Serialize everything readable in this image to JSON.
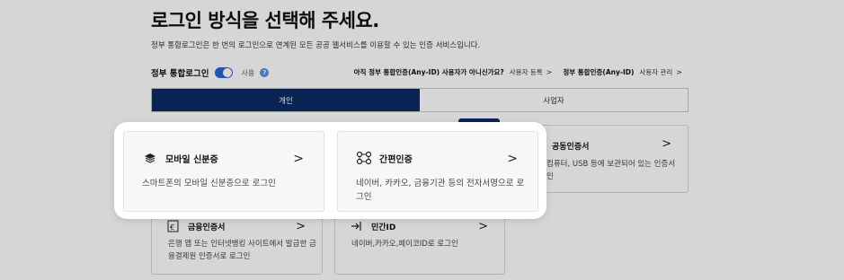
{
  "page": {
    "title": "로그인 방식을 선택해 주세요.",
    "description": "정부 통합로그인은 한 번의 로그인으로 연계된 모든 공공 웹서비스를 이용할 수 있는 인증 서비스입니다."
  },
  "integrated_login": {
    "label": "정부 통합로그인",
    "state": "사용",
    "help_icon": "help-icon",
    "enabled": true,
    "accent_color": "#2a63d6"
  },
  "links": {
    "question": "아직 정부 통합인증(Any-ID) 사용자가 아니신가요?",
    "register": "사용자 등록",
    "admin_prefix": "정부 통합인증(Any-ID)",
    "admin": "사용자 관리"
  },
  "tabs": [
    {
      "label": "개인",
      "active": true
    },
    {
      "label": "사업자",
      "active": false
    }
  ],
  "tab_active_color": "#0d2a66",
  "cards": {
    "joint_cert": {
      "title": "공동인증서",
      "body": "컴퓨터, USB 등에 보관되어 있는 인증서",
      "body2": "인",
      "icon": "certificate-icon"
    },
    "finance_cert": {
      "title": "금융인증서",
      "body": "은행 앱 또는 인터넷뱅킹 사이트에서 발급한 금",
      "body2": "융결제원 인증서로 로그인",
      "icon": "finance-cert-icon"
    },
    "private_id": {
      "title": "민간ID",
      "body": "네이버,카카오,페이코ID로 로그인",
      "icon": "login-arrow-icon"
    }
  },
  "popup": {
    "mobile_id": {
      "title": "모바일 신분증",
      "body": "스마트폰의 모바일 신분증으로 로그인",
      "icon": "mobile-id-icon"
    },
    "simple_auth": {
      "title": "간편인증",
      "body": "네이버, 카카오, 금융기관 등의 전자서명으로 로그인",
      "icon": "simple-auth-icon"
    }
  },
  "arrow_icon": "chevron-right-icon"
}
